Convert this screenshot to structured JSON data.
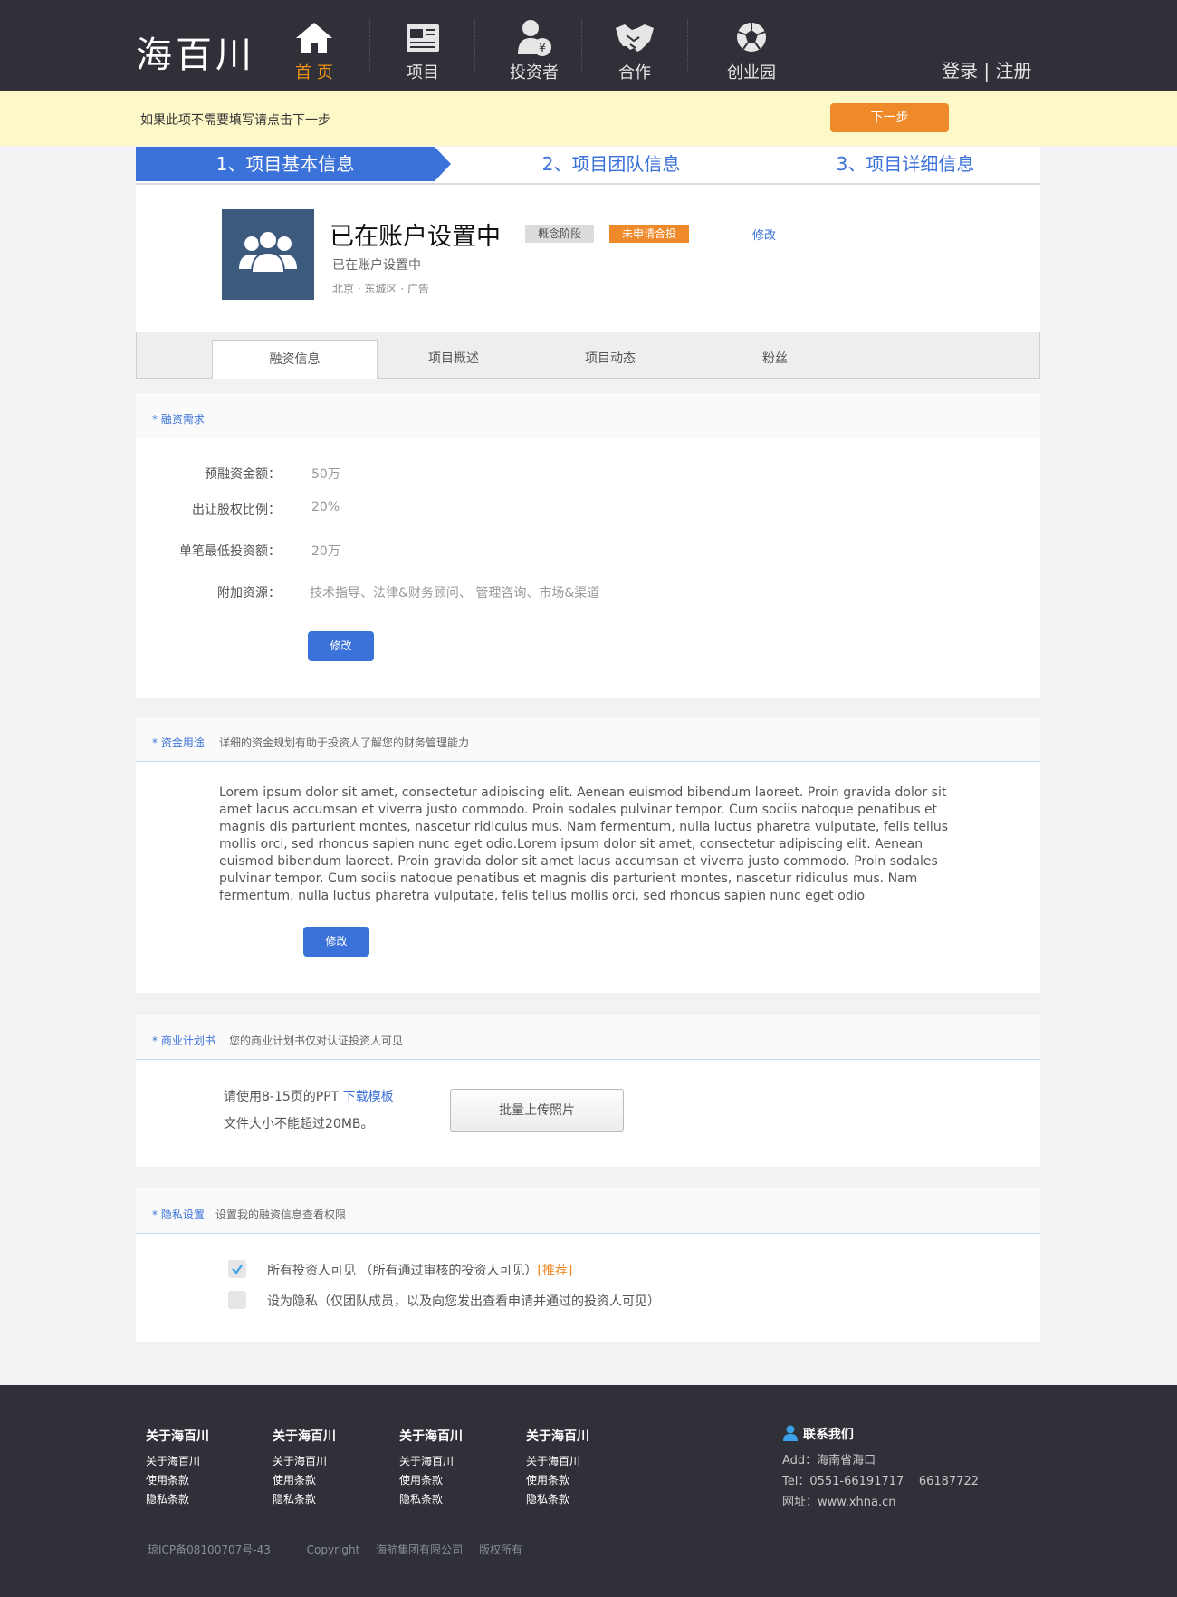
{
  "header": {
    "logo": "海百川",
    "nav": [
      {
        "label": "首 页",
        "icon": "home-icon",
        "active": true
      },
      {
        "label": "项目",
        "icon": "newspaper-icon"
      },
      {
        "label": "投资者",
        "icon": "investor-icon"
      },
      {
        "label": "合作",
        "icon": "handshake-icon"
      },
      {
        "label": "创业园",
        "icon": "ball-icon"
      }
    ],
    "login": "登录",
    "separator": "|",
    "register": "注册"
  },
  "notice": {
    "text": "如果此项不需要填写请点击下一步",
    "next_button": "下一步"
  },
  "steps": [
    "1、项目基本信息",
    "2、项目团队信息",
    "3、项目详细信息"
  ],
  "profile": {
    "name": "已在账户设置中",
    "tag_stage": "概念阶段",
    "tag_apply": "未申请合投",
    "edit": "修改",
    "subtitle": "已在账户设置中",
    "location": "北京 · 东城区 · 广告"
  },
  "tabs": [
    "融资信息",
    "项目概述",
    "项目动态",
    "粉丝"
  ],
  "funding": {
    "title": "融资需求",
    "rows": [
      {
        "label": "预融资金额：",
        "value": "50万"
      },
      {
        "label": "出让股权比例：",
        "value": "20%"
      },
      {
        "label": "单笔最低投资额：",
        "value": "20万"
      },
      {
        "label": "附加资源：",
        "value": "技术指导、法律&财务顾问、 管理咨询、市场&渠道"
      }
    ],
    "edit_button": "修改"
  },
  "usage": {
    "title": "资金用途",
    "desc": "详细的资金规划有助于投资人了解您的财务管理能力",
    "text": "Lorem ipsum dolor sit amet, consectetur adipiscing elit. Aenean euismod bibendum laoreet. Proin gravida dolor sit amet lacus accumsan et viverra justo commodo. Proin sodales pulvinar tempor. Cum sociis natoque penatibus et magnis dis parturient montes, nascetur ridiculus mus. Nam fermentum, nulla luctus pharetra vulputate, felis tellus mollis orci, sed rhoncus sapien nunc eget odio.Lorem ipsum dolor sit amet, consectetur adipiscing elit. Aenean euismod bibendum laoreet. Proin gravida dolor sit amet lacus accumsan et viverra justo commodo. Proin sodales pulvinar tempor. Cum sociis natoque penatibus et magnis dis parturient montes, nascetur ridiculus mus. Nam fermentum, nulla luctus pharetra vulputate, felis tellus mollis orci, sed rhoncus sapien nunc eget odio",
    "edit_button": "修改"
  },
  "plan": {
    "title": "商业计划书",
    "desc": "您的商业计划书仅对认证投资人可见",
    "hint_prefix": "请使用8-15页的PPT ",
    "hint_link": "下载模板",
    "hint_line2": "文件大小不能超过20MB。",
    "upload_button": "批量上传照片"
  },
  "privacy": {
    "title": "隐私设置",
    "desc": "设置我的融资信息查看权限",
    "option1": "所有投资人可见 （所有通过审核的投资人可见）",
    "option1_tag": "[推荐]",
    "option1_checked": true,
    "option2": "设为隐私（仅团队成员，以及向您发出查看申请并通过的投资人可见）",
    "option2_checked": false
  },
  "footer": {
    "columns": [
      {
        "title": "关于海百川",
        "items": [
          "关于海百川",
          "使用条款",
          "隐私条款"
        ]
      },
      {
        "title": "关于海百川",
        "items": [
          "关于海百川",
          "使用条款",
          "隐私条款"
        ]
      },
      {
        "title": "关于海百川",
        "items": [
          "关于海百川",
          "使用条款",
          "隐私条款"
        ]
      },
      {
        "title": "关于海百川",
        "items": [
          "关于海百川",
          "使用条款",
          "隐私条款"
        ]
      }
    ],
    "contact_title": "联系我们",
    "address": "Add：海南省海口",
    "tel": "Tel：0551-66191717    66187722",
    "website": "网址：www.xhna.cn",
    "icp": "琼ICP备08100707号-43",
    "copyright": "Copyright",
    "company": "海航集团有限公司",
    "rights": "版权所有"
  },
  "colors": {
    "header_bg": "#2f3038",
    "accent_blue": "#3b72d9",
    "accent_orange": "#ee8a2a",
    "notice_bg": "#fdf8c8"
  }
}
